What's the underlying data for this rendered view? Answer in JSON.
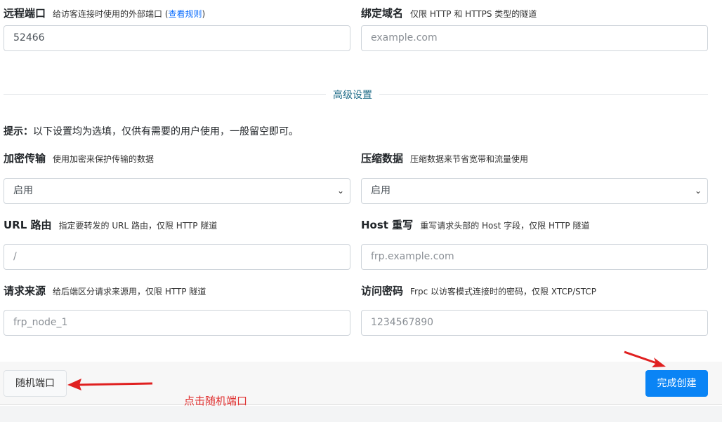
{
  "remote_port": {
    "label": "远程端口",
    "help": "给访客连接时使用的外部端口 (",
    "link": "查看规则",
    "help_end": ")",
    "value": "52466"
  },
  "domain": {
    "label": "绑定域名",
    "help": "仅限 HTTP 和 HTTPS 类型的隧道",
    "placeholder": "example.com"
  },
  "advanced_title": "高级设置",
  "hint": {
    "prefix": "提示：",
    "text": "以下设置均为选填，仅供有需要的用户使用，一般留空即可。"
  },
  "encryption": {
    "label": "加密传输",
    "help": "使用加密来保护传输的数据",
    "value": "启用"
  },
  "compression": {
    "label": "压缩数据",
    "help": "压缩数据来节省宽带和流量使用",
    "value": "启用"
  },
  "url_route": {
    "label": "URL 路由",
    "help": "指定要转发的 URL 路由，仅限 HTTP 隧道",
    "placeholder": "/"
  },
  "host_rewrite": {
    "label": "Host 重写",
    "help": "重写请求头部的 Host 字段，仅限 HTTP 隧道",
    "placeholder": "frp.example.com"
  },
  "request_source": {
    "label": "请求来源",
    "help": "给后端区分请求来源用，仅限 HTTP 隧道",
    "placeholder": "frp_node_1"
  },
  "access_password": {
    "label": "访问密码",
    "help": "Frpc 以访客模式连接时的密码，仅限 XTCP/STCP",
    "placeholder": "1234567890"
  },
  "buttons": {
    "random_port": "随机端口",
    "create": "完成创建"
  },
  "annotation": "点击随机端口"
}
